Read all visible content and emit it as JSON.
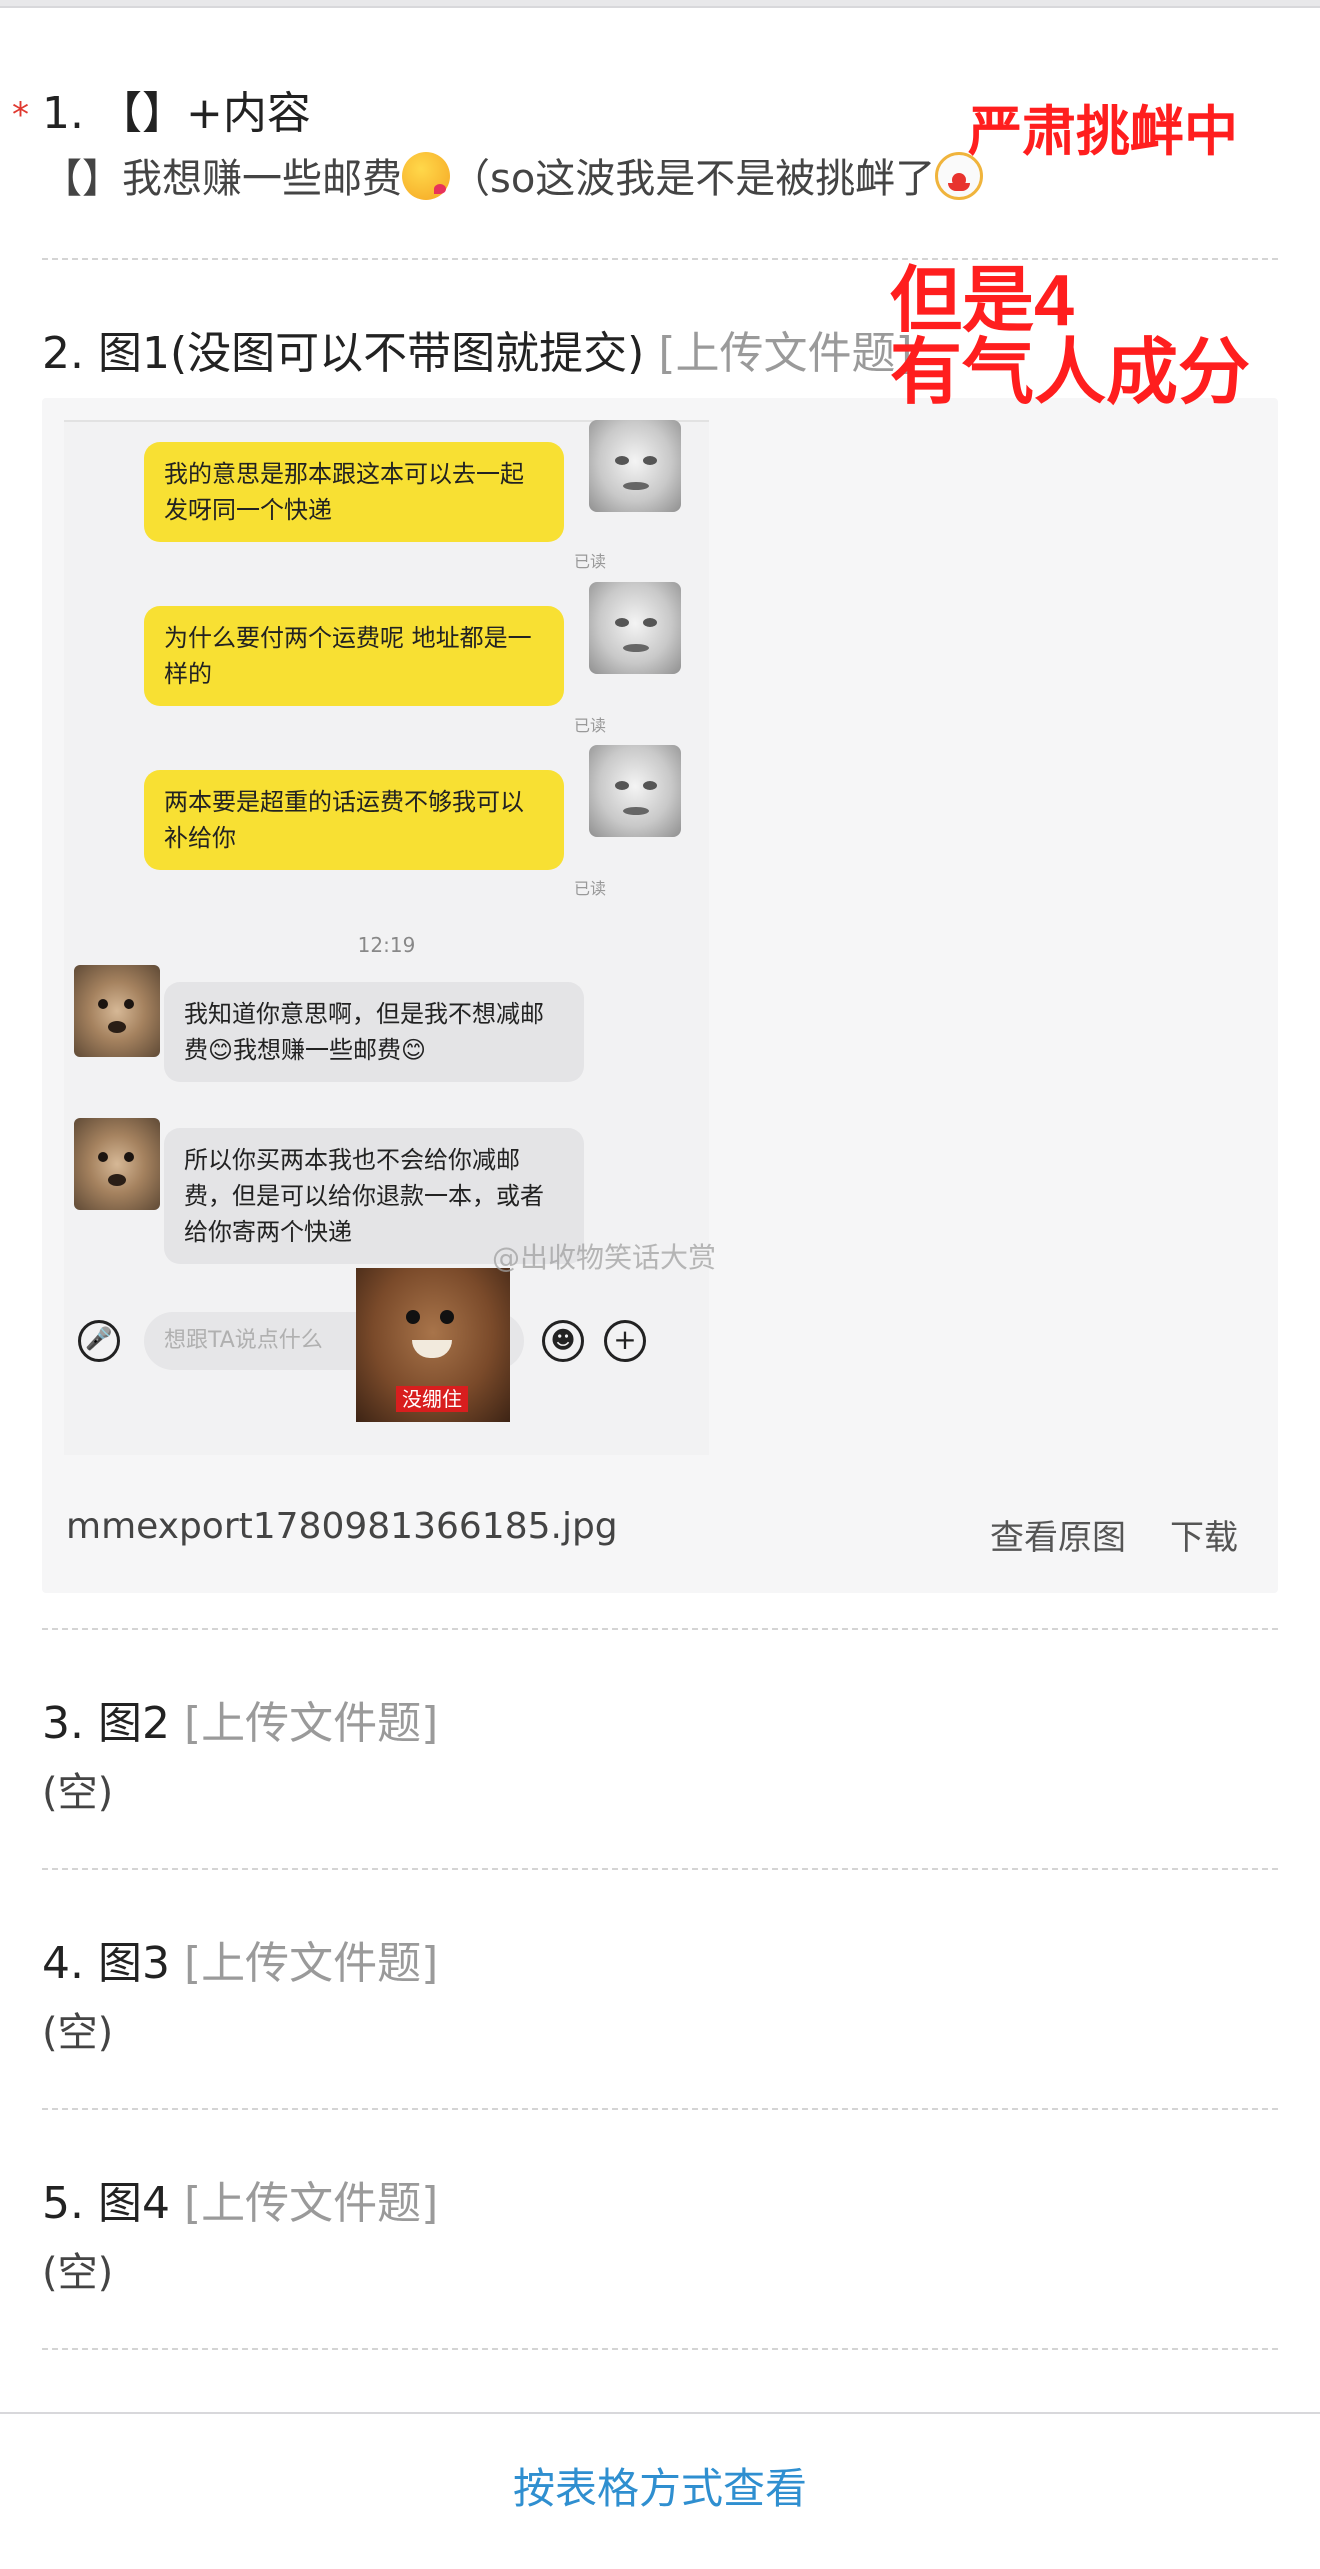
{
  "questions": [
    {
      "number": "1.",
      "title": "【】+内容",
      "answer_text": "【】我想赚一些邮费",
      "answer_suffix": "（so这波我是不是被挑衅了",
      "required_mark": "*",
      "kiss_emoji": "kissing-face-emoji",
      "clown_emoji": "clown-face-emoji"
    },
    {
      "number": "2.",
      "title": "图1(没图可以不带图就提交)",
      "type_label": "[上传文件题]"
    },
    {
      "number": "3.",
      "title": "图2",
      "type_label": "[上传文件题]",
      "answer_text": "(空)"
    },
    {
      "number": "4.",
      "title": "图3",
      "type_label": "[上传文件题]",
      "answer_text": "(空)"
    },
    {
      "number": "5.",
      "title": "图4",
      "type_label": "[上传文件题]",
      "answer_text": "(空)"
    }
  ],
  "overlays": {
    "annotation_1": "严肃挑衅中",
    "annotation_2_line1": "但是4",
    "annotation_2_line2": "有气人成分",
    "color": "#ff1e1e"
  },
  "attachment": {
    "file_name": "mmexport1780981366185.jpg",
    "view_original": "查看原图",
    "download": "下载",
    "chat": {
      "sent_messages": [
        {
          "text": "我的意思是那本跟这本可以去一起发呀同一个快递",
          "status": "已读"
        },
        {
          "text": "为什么要付两个运费呢 地址都是一样的",
          "status": "已读"
        },
        {
          "text": "两本要是超重的话运费不够我可以补给你",
          "status": "已读"
        }
      ],
      "time": "12:19",
      "received_messages": [
        {
          "text": "我知道你意思啊，但是我不想减邮费😊我想赚一些邮费😊"
        },
        {
          "text": "所以你买两本我也不会给你减邮费，但是可以给你退款一本，或者给你寄两个快递"
        }
      ],
      "input_placeholder": "想跟TA说点什么",
      "sticker_caption": "没绷住",
      "watermark": "@出收物笑话大赏"
    }
  },
  "footer": {
    "table_view_link": "按表格方式查看",
    "link_color": "#2f8fd0"
  }
}
